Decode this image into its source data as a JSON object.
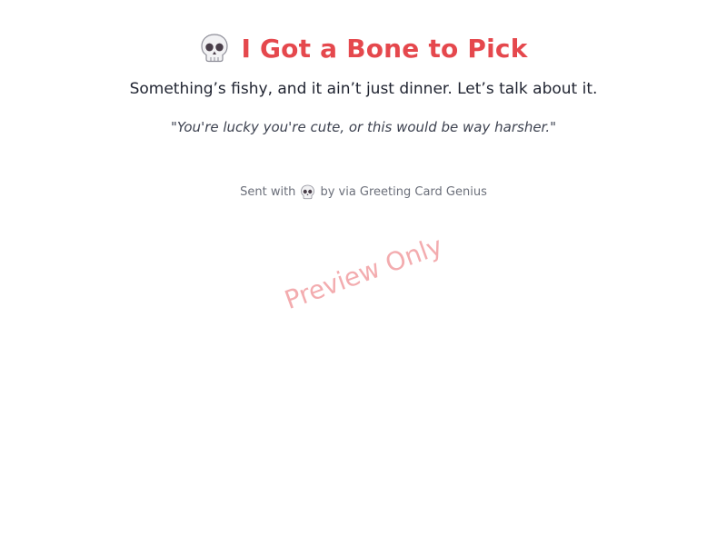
{
  "card": {
    "title_icon": "skull-icon",
    "title": "I Got a Bone to Pick",
    "subtitle": "Something’s fishy, and it ain’t just dinner. Let’s talk about it.",
    "quote": "\"You're lucky you're cute, or this would be way harsher.\"",
    "footer": {
      "prefix": "Sent with",
      "icon": "skull-icon",
      "suffix": "by via Greeting Card Genius"
    },
    "watermark": "Preview Only"
  },
  "colors": {
    "title": "#e5484d",
    "body_text": "#1f2330",
    "quote_text": "#3d4250",
    "footer_text": "#6b6f7a",
    "watermark": "#e5484d"
  }
}
